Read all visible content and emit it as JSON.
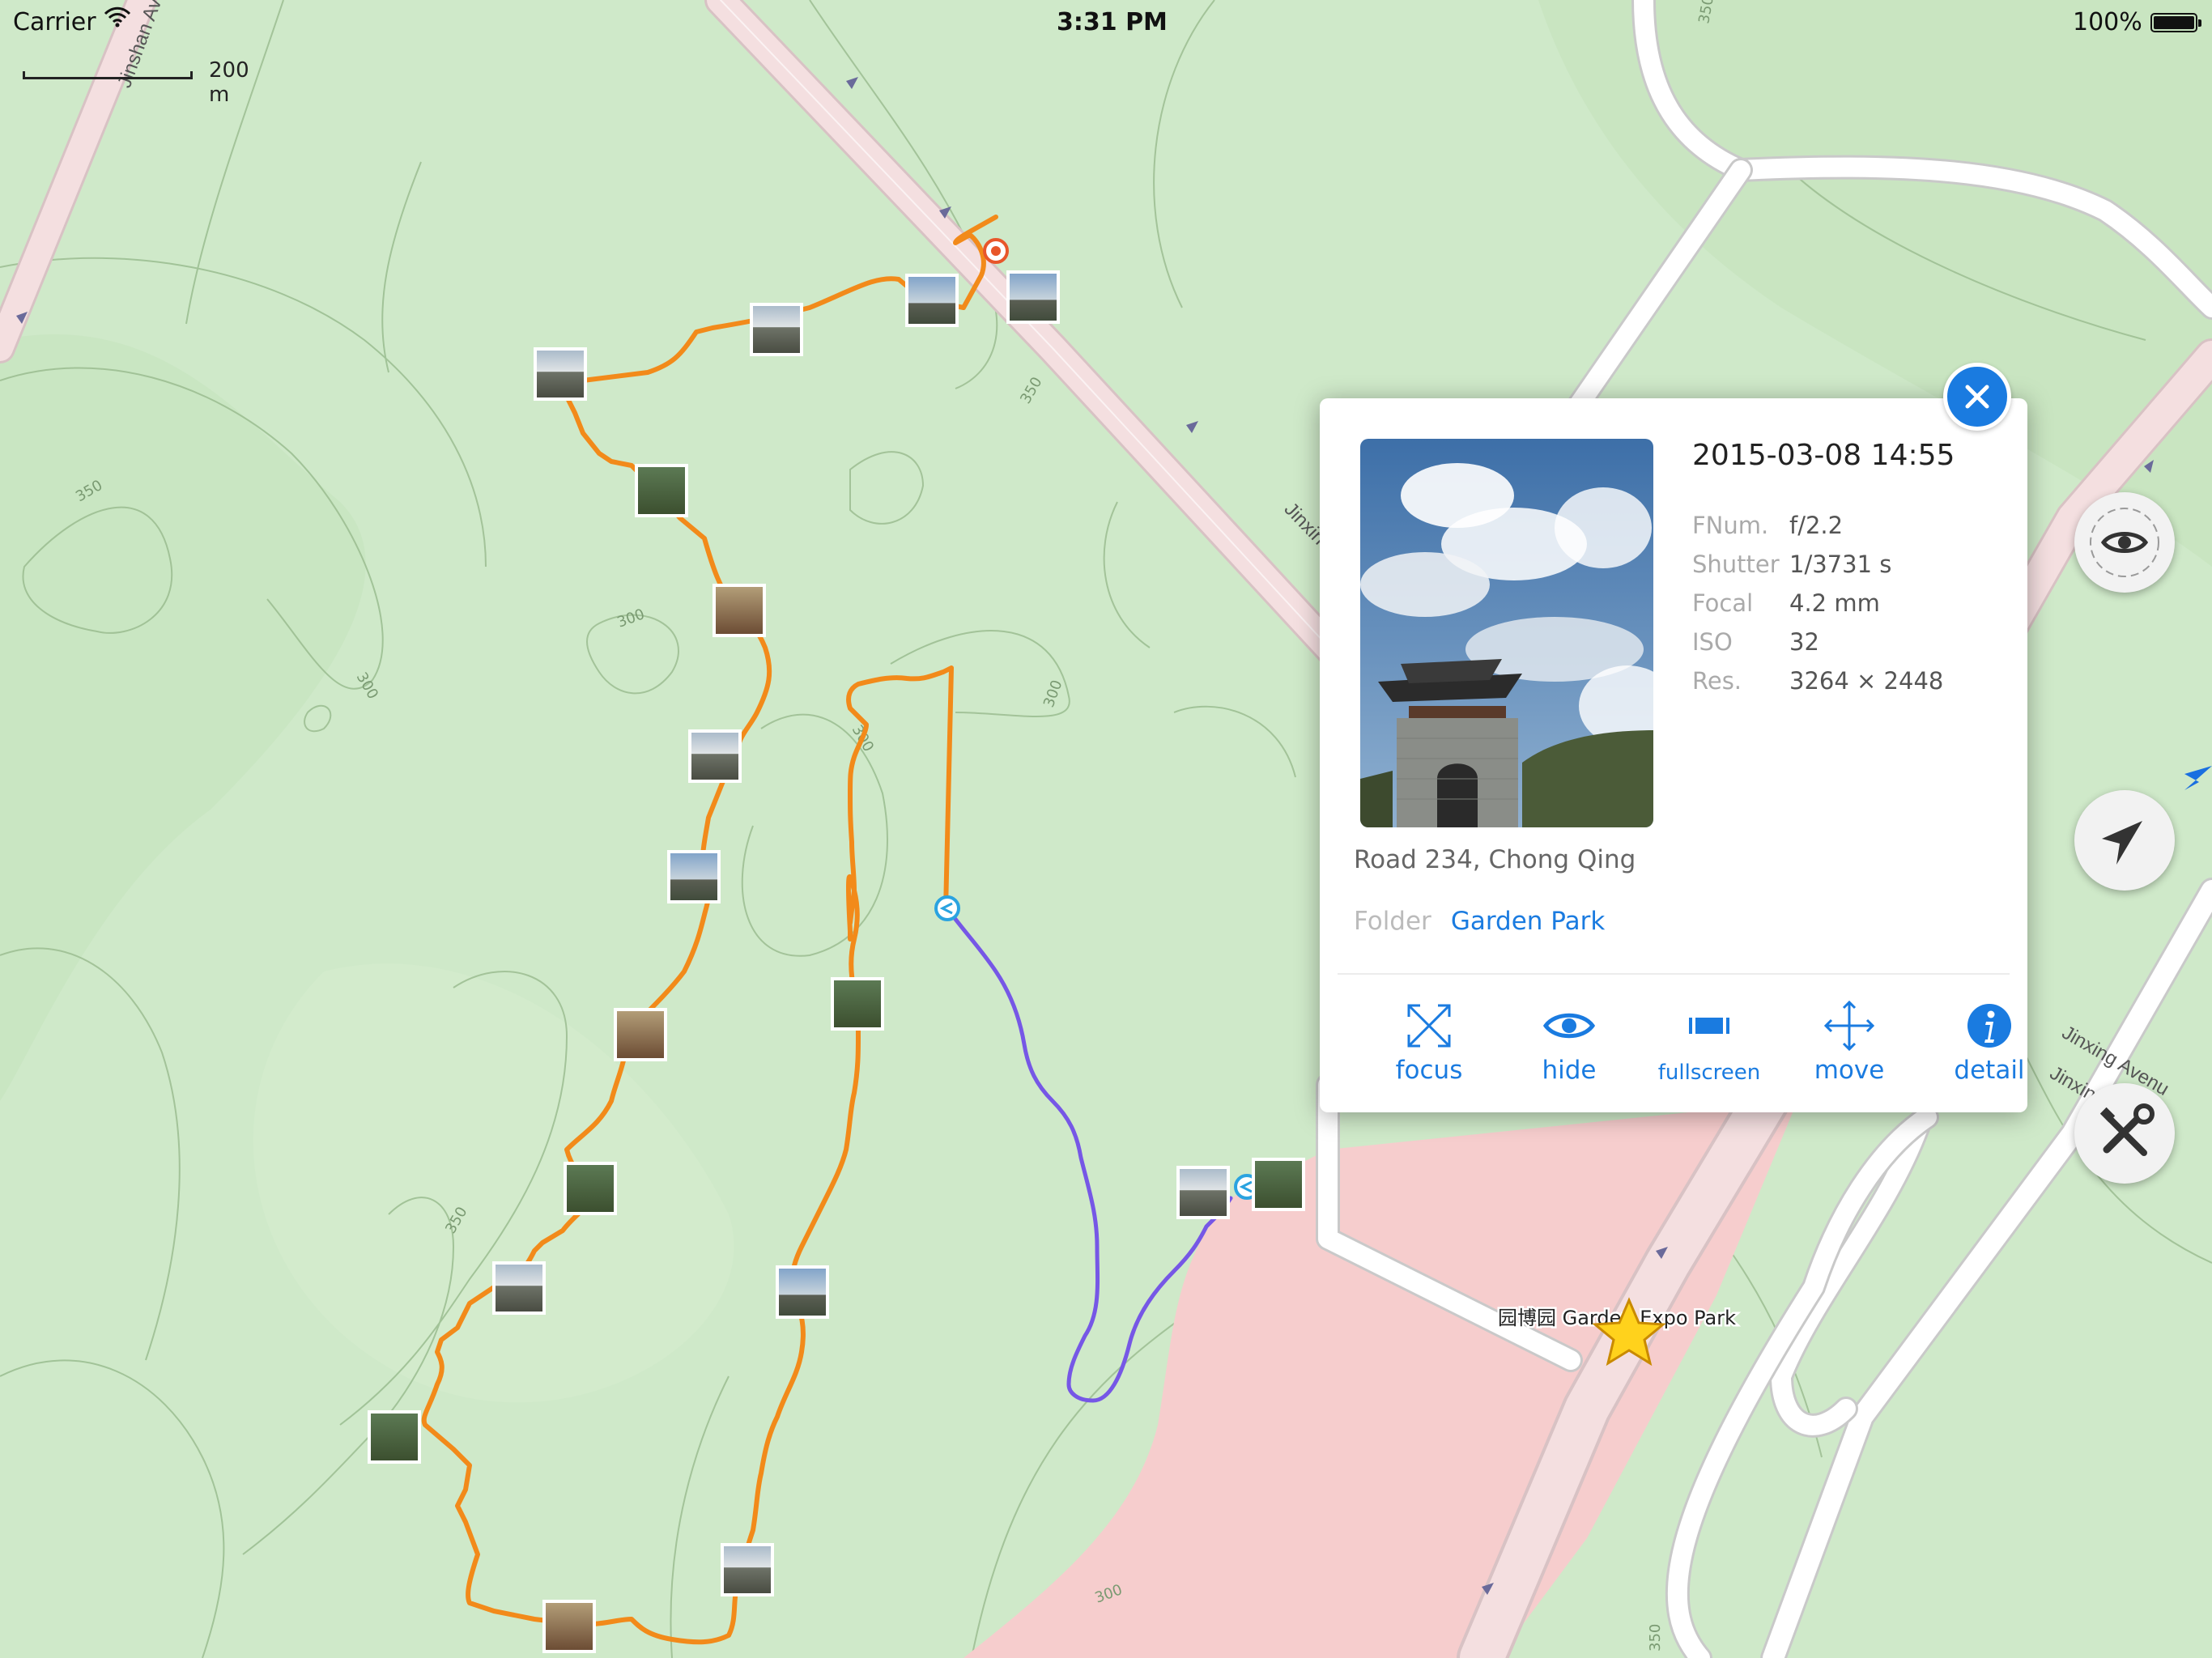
{
  "status_bar": {
    "carrier": "Carrier",
    "time": "3:31 PM",
    "battery": "100%"
  },
  "map": {
    "scale_label": "200 m",
    "street_labels": {
      "jinshan": "Jinshan Ave",
      "jinxing_upper": "Jinxin",
      "jinxing_right": "Jinxing Avenu",
      "jinxing_right2": "Jinxin"
    },
    "contour_labels": [
      "350",
      "300",
      "300",
      "300",
      "300",
      "350",
      "350",
      "350",
      "300",
      "350",
      "350"
    ],
    "poi_label": "园博园 Garden Expo Park",
    "colors": {
      "land": "#cfe9c9",
      "road": "#f4dfe0",
      "park_zone": "#f6cdcd",
      "track": "#f28a1a",
      "track_blue": "#7657e6",
      "accent": "#1a7be0"
    },
    "photo_markers": 24
  },
  "popup": {
    "date": "2015-03-08 14:55",
    "meta": [
      {
        "key": "FNum.",
        "value": "f/2.2"
      },
      {
        "key": "Shutter",
        "value": "1/3731 s"
      },
      {
        "key": "Focal",
        "value": "4.2 mm"
      },
      {
        "key": "ISO",
        "value": "32"
      },
      {
        "key": "Res.",
        "value": "3264 × 2448"
      }
    ],
    "address": "Road 234, Chong Qing",
    "folder_key": "Folder",
    "folder_value": "Garden Park",
    "actions": [
      {
        "label": "focus",
        "icon": "focus-arrows-icon"
      },
      {
        "label": "hide",
        "icon": "eye-icon"
      },
      {
        "label": "fullscreen",
        "icon": "fullscreen-icon"
      },
      {
        "label": "move",
        "icon": "move-arrows-icon"
      },
      {
        "label": "detail",
        "icon": "info-icon"
      }
    ]
  },
  "side_buttons": [
    {
      "icon": "eye-icon"
    },
    {
      "icon": "location-arrow-icon"
    },
    {
      "icon": "tools-icon"
    }
  ]
}
